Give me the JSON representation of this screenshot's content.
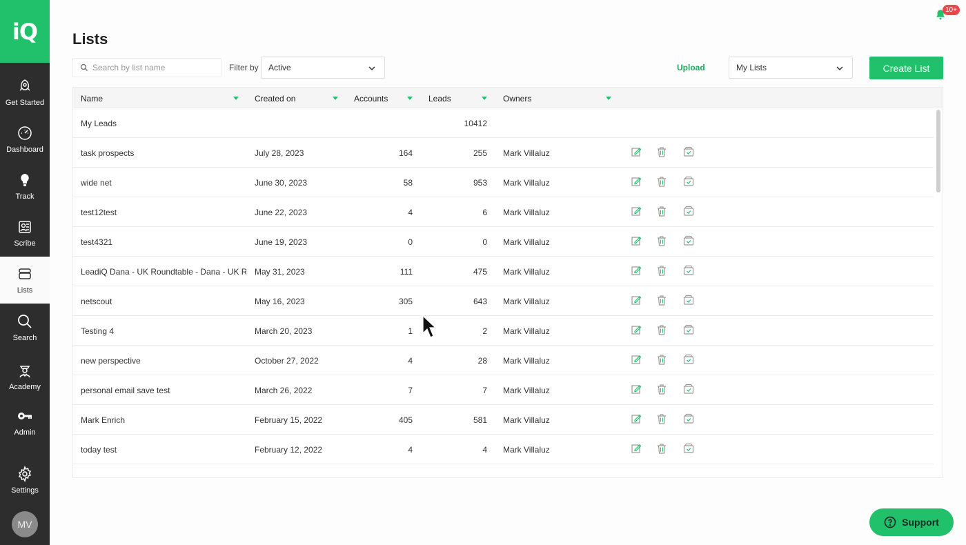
{
  "sidebar": {
    "logo_text": "iQ",
    "items": [
      {
        "label": "Get Started",
        "icon": "rocket-icon"
      },
      {
        "label": "Dashboard",
        "icon": "gauge-icon"
      },
      {
        "label": "Track",
        "icon": "lightbulb-icon"
      },
      {
        "label": "Scribe",
        "icon": "scribe-icon"
      },
      {
        "label": "Lists",
        "icon": "stack-icon"
      },
      {
        "label": "Search",
        "icon": "search-icon"
      },
      {
        "label": "Academy",
        "icon": "academy-icon"
      },
      {
        "label": "Admin",
        "icon": "key-icon"
      },
      {
        "label": "Settings",
        "icon": "gear-icon"
      }
    ],
    "active_item": "Lists",
    "avatar_initials": "MV"
  },
  "header": {
    "title": "Lists",
    "notification_badge": "10+"
  },
  "toolbar": {
    "search_placeholder": "Search by list name",
    "filter_label": "Filter by",
    "filter_value": "Active",
    "upload_label": "Upload",
    "lists_scope_value": "My Lists",
    "create_label": "Create List"
  },
  "table": {
    "columns": [
      "Name",
      "Created on",
      "Accounts",
      "Leads",
      "Owners"
    ],
    "rows": [
      {
        "name": "My Leads",
        "created": "",
        "accounts": "",
        "leads": "10412",
        "owner": "",
        "actions": false
      },
      {
        "name": "task prospects",
        "created": "July 28, 2023",
        "accounts": "164",
        "leads": "255",
        "owner": "Mark Villaluz",
        "actions": true
      },
      {
        "name": "wide net",
        "created": "June 30, 2023",
        "accounts": "58",
        "leads": "953",
        "owner": "Mark Villaluz",
        "actions": true
      },
      {
        "name": "test12test",
        "created": "June 22, 2023",
        "accounts": "4",
        "leads": "6",
        "owner": "Mark Villaluz",
        "actions": true
      },
      {
        "name": "test4321",
        "created": "June 19, 2023",
        "accounts": "0",
        "leads": "0",
        "owner": "Mark Villaluz",
        "actions": true
      },
      {
        "name": "LeadiQ Dana - UK Roundtable - Dana - UK Roun",
        "created": "May 31, 2023",
        "accounts": "111",
        "leads": "475",
        "owner": "Mark Villaluz",
        "actions": true
      },
      {
        "name": "netscout",
        "created": "May 16, 2023",
        "accounts": "305",
        "leads": "643",
        "owner": "Mark Villaluz",
        "actions": true
      },
      {
        "name": "Testing 4",
        "created": "March 20, 2023",
        "accounts": "1",
        "leads": "2",
        "owner": "Mark Villaluz",
        "actions": true
      },
      {
        "name": "new perspective",
        "created": "October 27, 2022",
        "accounts": "4",
        "leads": "28",
        "owner": "Mark Villaluz",
        "actions": true
      },
      {
        "name": "personal email save test",
        "created": "March 26, 2022",
        "accounts": "7",
        "leads": "7",
        "owner": "Mark Villaluz",
        "actions": true
      },
      {
        "name": "Mark Enrich",
        "created": "February 15, 2022",
        "accounts": "405",
        "leads": "581",
        "owner": "Mark Villaluz",
        "actions": true
      },
      {
        "name": "today test",
        "created": "February 12, 2022",
        "accounts": "4",
        "leads": "4",
        "owner": "Mark Villaluz",
        "actions": true
      }
    ]
  },
  "support": {
    "label": "Support"
  },
  "colors": {
    "brand": "#21c16b",
    "sidebar": "#2d2d2d",
    "badge": "#e8474b"
  }
}
